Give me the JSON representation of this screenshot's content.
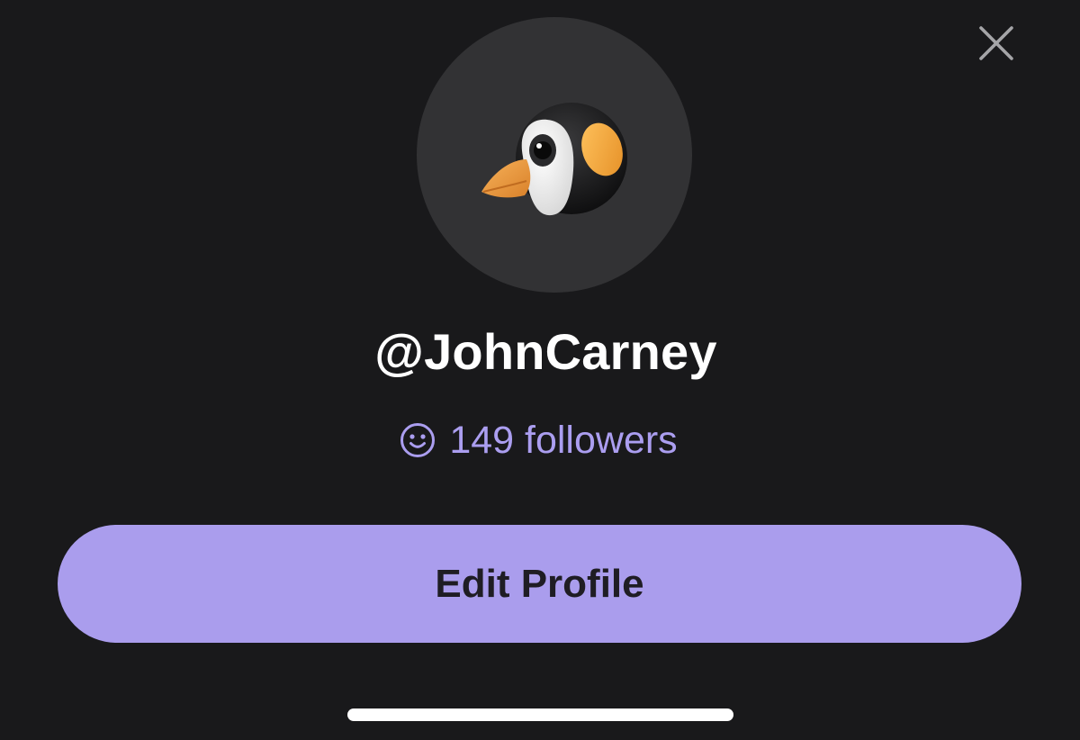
{
  "header": {
    "close_icon": "close-icon"
  },
  "profile": {
    "avatar_icon": "puffin-emoji-icon",
    "username": "@JohnCarney",
    "followers_icon": "smile-icon",
    "followers_text": "149 followers",
    "followers_color": "#ab9ef0"
  },
  "actions": {
    "edit_profile_label": "Edit Profile",
    "button_color": "#aa9ded"
  },
  "theme": {
    "background": "#19191b",
    "avatar_background": "#323234"
  }
}
